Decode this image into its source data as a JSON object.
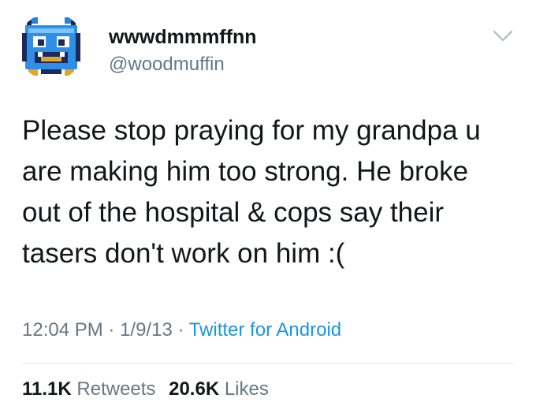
{
  "user": {
    "display_name": "wwwdmmmffnn",
    "handle": "@woodmuffin",
    "avatar_icon": "pixel-monster-avatar"
  },
  "menu_icon": "chevron-down-icon",
  "tweet": {
    "lines": [
      "Please stop praying for my grandpa u",
      "are making him too strong. He broke",
      "out of the hospital & cops say their",
      "tasers don't work on him :("
    ]
  },
  "meta": {
    "time": "12:04 PM",
    "separator1": " · ",
    "date": "1/9/13",
    "separator2": " · ",
    "source": "Twitter for Android"
  },
  "stats": {
    "retweets_count": "11.1K",
    "retweets_label": "Retweets",
    "likes_count": "20.6K",
    "likes_label": "Likes"
  },
  "colors": {
    "text": "#14171a",
    "secondary": "#657786",
    "link": "#1b95e0",
    "divider": "#e1e8ed"
  }
}
